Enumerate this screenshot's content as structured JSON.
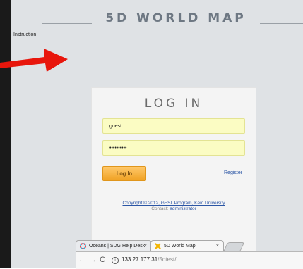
{
  "site": {
    "title": "5D WORLD MAP",
    "instruction_link": "Instruction"
  },
  "colors": {
    "background": "#dfe2e5",
    "accent_arrow": "#e8160c",
    "field_fill": "#fbfcc3",
    "button": "#f0a224",
    "link": "#2a55a5"
  },
  "login": {
    "title": "LOG IN",
    "username_value": "guest",
    "password_value": "••••••••••",
    "login_button": "Log In",
    "register_link": "Register"
  },
  "footer": {
    "copyright": "Copyright © 2012, GESL Program, Keio University",
    "contact_label": "Contact:",
    "contact_link": "administrator"
  },
  "browser": {
    "tabs": [
      {
        "label": "Oceans | SDG Help Desk",
        "icon": "sdg-wheel-icon",
        "close": "×"
      },
      {
        "label": "5D World Map",
        "icon": "world-map-favicon-icon",
        "close": "×"
      }
    ],
    "nav": {
      "back": "←",
      "forward": "→",
      "reload": "C",
      "info": "i"
    },
    "url_host": "133.27.177.31",
    "url_path": "/5dtest/"
  }
}
